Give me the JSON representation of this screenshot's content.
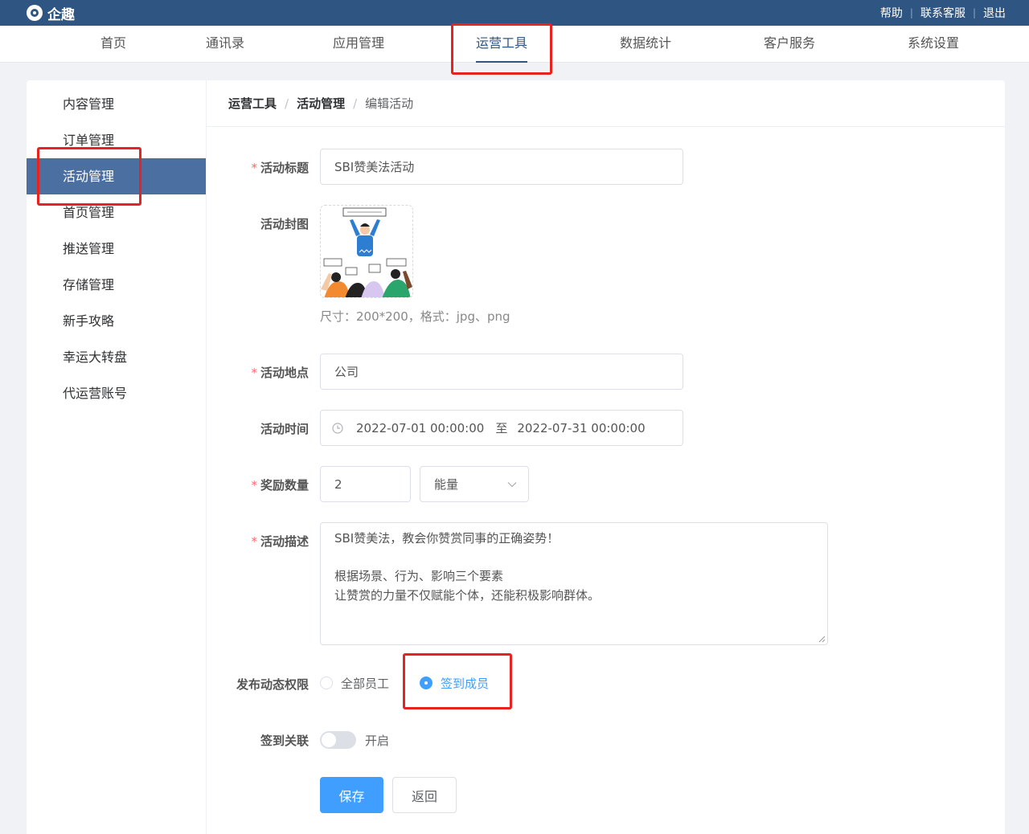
{
  "app": {
    "logo_text": "企趣",
    "logo_icon": "qiqu-logo-icon"
  },
  "top_links": [
    "帮助",
    "联系客服",
    "退出"
  ],
  "main_nav": [
    "首页",
    "通讯录",
    "应用管理",
    "运营工具",
    "数据统计",
    "客户服务",
    "系统设置"
  ],
  "sidebar": [
    "内容管理",
    "订单管理",
    "活动管理",
    "首页管理",
    "推送管理",
    "存储管理",
    "新手攻略",
    "幸运大转盘",
    "代运营账号"
  ],
  "breadcrumb": [
    "运营工具",
    "活动管理",
    "编辑活动"
  ],
  "form": {
    "title_label": "活动标题",
    "title_value": "SBI赞美法活动",
    "cover_label": "活动封图",
    "cover_hint": "尺寸：200*200，格式：jpg、png",
    "cover_image_alt": "people-cheering-illustration",
    "location_label": "活动地点",
    "location_value": "公司",
    "time_label": "活动时间",
    "time_start": "2022-07-01 00:00:00",
    "time_sep": "至",
    "time_end": "2022-07-31 00:00:00",
    "reward_label": "奖励数量",
    "reward_value": "2",
    "reward_unit": "能量",
    "desc_label": "活动描述",
    "desc_lines": [
      "SBI赞美法，教会你赞赏同事的正确姿势！",
      "",
      "根据场景、行为、影响三个要素",
      "让赞赏的力量不仅赋能个体，还能积极影响群体。"
    ],
    "perm_label": "发布动态权限",
    "perm_options": [
      "全部员工",
      "签到成员"
    ],
    "perm_selected": "签到成员",
    "signin_label": "签到关联",
    "signin_toggle_text": "开启",
    "signin_enabled": false,
    "save_button": "保存",
    "back_button": "返回"
  },
  "colors": {
    "header": "#2f5682",
    "accent": "#409eff",
    "sidebar_active": "#4a6fa0",
    "highlight_box": "#e8231f"
  },
  "state": {
    "active_nav": "运营工具",
    "active_sidebar": "活动管理"
  }
}
